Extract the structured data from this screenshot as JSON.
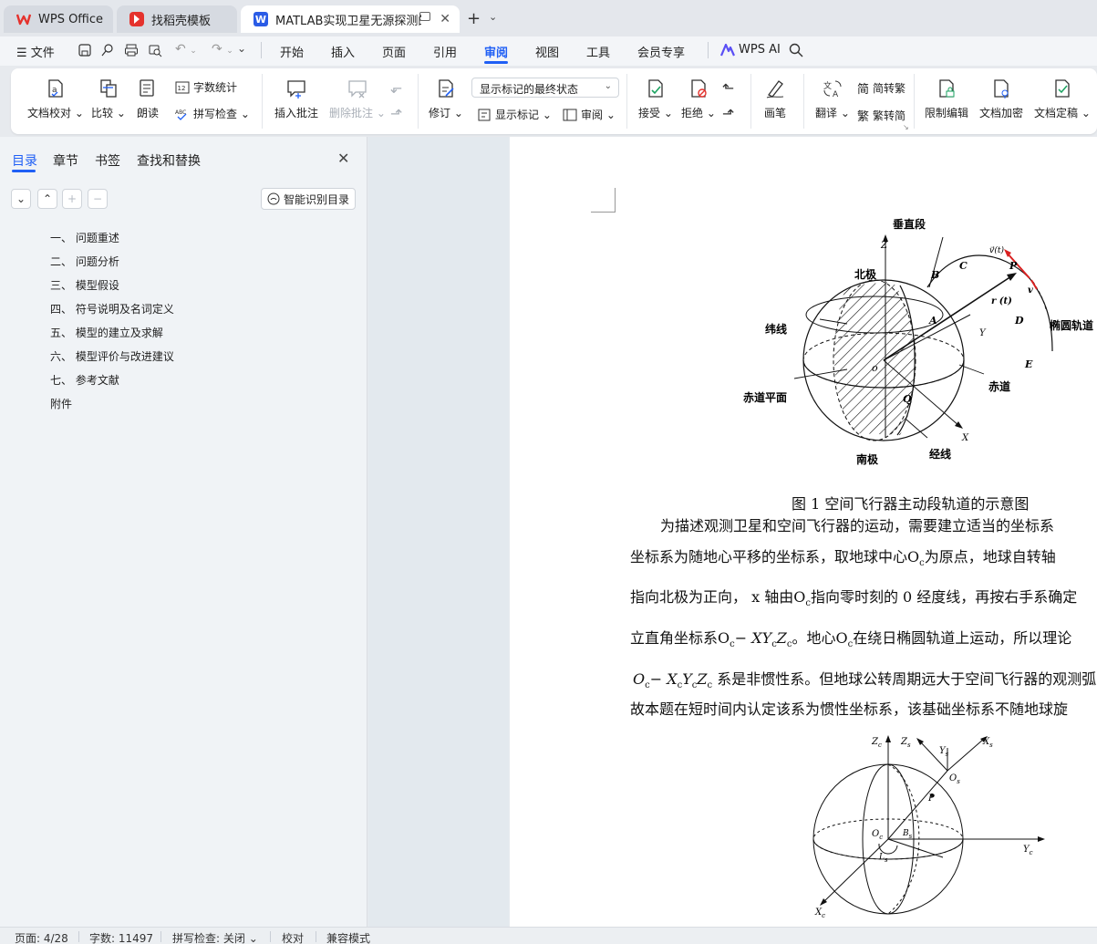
{
  "tabs": [
    {
      "label": "WPS Office",
      "icon": "wps-logo-icon"
    },
    {
      "label": "找稻壳模板",
      "icon": "docer-icon"
    },
    {
      "label": "MATLAB实现卫星无源探测的飞",
      "icon": "word-doc-icon",
      "active": true
    }
  ],
  "menu": {
    "file": "文件",
    "items": [
      "开始",
      "插入",
      "页面",
      "引用",
      "审阅",
      "视图",
      "工具",
      "会员专享"
    ],
    "active": "审阅",
    "ai": "WPS AI"
  },
  "ribbon": {
    "proofread": "文档校对",
    "compare": "比较",
    "read_aloud": "朗读",
    "word_count": "字数统计",
    "spell_check": "拼写检查",
    "insert_comment": "插入批注",
    "delete_comment": "删除批注",
    "revise": "修订",
    "markup_state": "显示标记的最终状态",
    "show_markup": "显示标记",
    "review": "审阅",
    "accept": "接受",
    "reject": "拒绝",
    "pen": "画笔",
    "translate": "翻译",
    "to_traditional": "简转繁",
    "to_simplified": "繁转简",
    "restrict_edit": "限制编辑",
    "encrypt": "文档加密",
    "finalize": "文档定稿"
  },
  "nav": {
    "tabs": [
      "目录",
      "章节",
      "书签",
      "查找和替换"
    ],
    "active": "目录",
    "smart_toc": "智能识别目录",
    "toc": [
      "一、 问题重述",
      "二、 问题分析",
      "三、 模型假设",
      "四、 符号说明及名词定义",
      "五、 模型的建立及求解",
      "六、 模型评价与改进建议",
      "七、 参考文献",
      "附件"
    ]
  },
  "document": {
    "figure1": {
      "labels": {
        "vertical": "垂直段",
        "north": "北极",
        "latitude": "纬线",
        "equator_plane": "赤道平面",
        "equator": "赤道",
        "south": "南极",
        "longitude": "经线",
        "ellipse": "椭圆轨道",
        "zc": "Z",
        "yc": "Y",
        "xc": "X",
        "o": "o",
        "a": "A",
        "b": "B",
        "c": "C",
        "d": "D",
        "e": "E",
        "p": "P",
        "q": "Q",
        "v": "v",
        "rt": "r (t)",
        "vt": "v⃗(t)"
      },
      "caption": "图 1 空间飞行器主动段轨道的示意图"
    },
    "paragraphs": [
      "为描述观测卫星和空间飞行器的运动，需要建立适当的坐标系",
      "坐标系为随地心平移的坐标系，取地球中心O",
      "为原点，地球自转轴",
      "指向北极为正向，  x 轴由O",
      "指向零时刻的 0 经度线，再按右手系确定",
      "立直角坐标系O",
      "− X",
      "。地心O",
      "在绕日椭圆轨道上运动，所以理论",
      "系是非惯性系。但地球公转周期远大于空间飞行器的观测弧",
      "故本题在短时间内认定该系为惯性坐标系，该基础坐标系不随地球旋"
    ],
    "figure2": {
      "zc": "Z",
      "zs": "Z",
      "ys": "Y",
      "xs": "X",
      "os": "O",
      "p": "P",
      "oc": "O",
      "bs": "B",
      "ls": "L",
      "yc": "Y",
      "xc": "X",
      "sub_c": "c",
      "sub_s": "s"
    }
  },
  "status": {
    "page": "页面: 4/28",
    "words": "字数: 11497",
    "spell": "拼写检查: 关闭",
    "proof": "校对",
    "compat": "兼容模式"
  },
  "colors": {
    "accent": "#1f5ff5",
    "wps_red": "#e5322d",
    "doc_blue": "#2b5ce6"
  }
}
